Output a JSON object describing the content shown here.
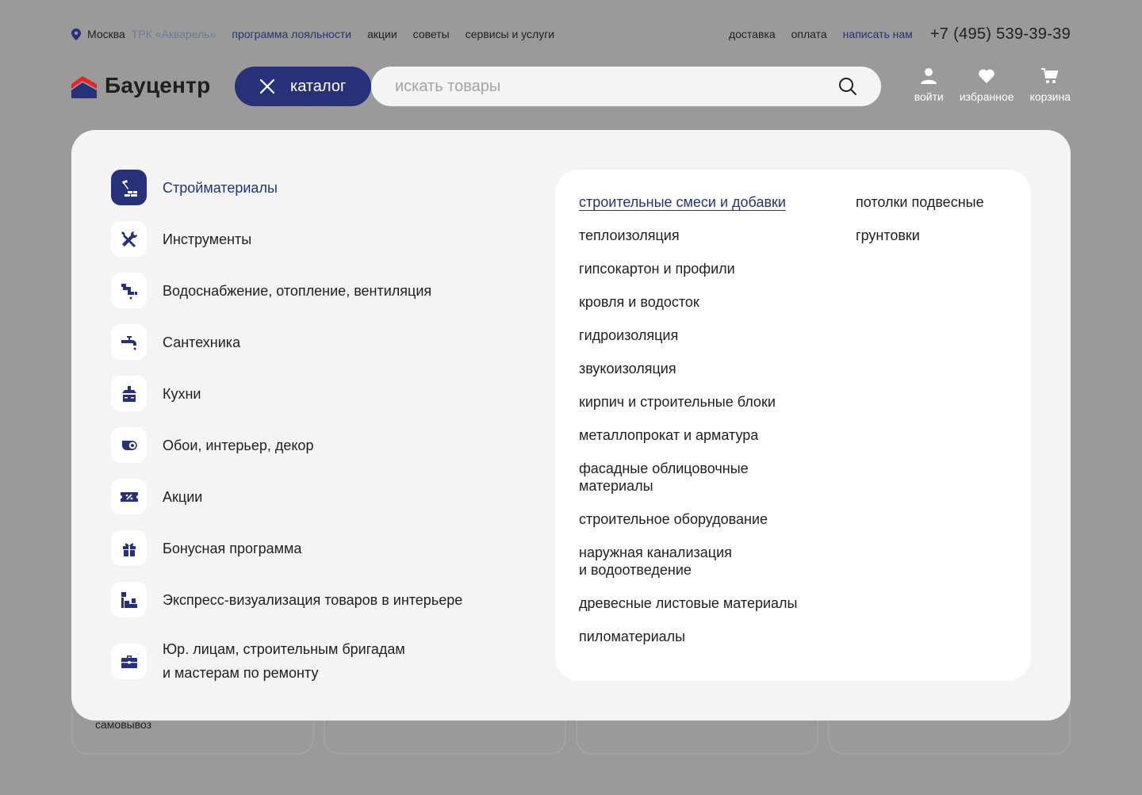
{
  "topbar": {
    "city": "Москва",
    "store": "ТРК «Акварель»",
    "loyalty": "программа лояльности",
    "links": [
      "акции",
      "советы",
      "сервисы и услуги"
    ],
    "right_links": [
      "доставка",
      "оплата"
    ],
    "write_us": "написать нам",
    "phone": "+7 (495) 539-39-39"
  },
  "header": {
    "logo_text": "Бауцентр",
    "catalog_label": "каталог",
    "search_placeholder": "искать товары",
    "login": "войти",
    "favorites": "избранное",
    "cart": "корзина"
  },
  "background": {
    "card_text": "самовывоз"
  },
  "menu": {
    "categories": [
      {
        "label": "Стройматериалы",
        "icon": "bricks-trowel-icon"
      },
      {
        "label": "Инструменты",
        "icon": "tools-icon"
      },
      {
        "label": "Водоснабжение, отопление, вентиляция",
        "icon": "pipe-icon"
      },
      {
        "label": "Сантехника",
        "icon": "faucet-icon"
      },
      {
        "label": "Кухни",
        "icon": "kitchen-hood-icon"
      },
      {
        "label": "Обои, интерьер, декор",
        "icon": "wallpaper-roll-icon"
      },
      {
        "label": "Акции",
        "icon": "discount-ticket-icon"
      },
      {
        "label": "Бонусная программа",
        "icon": "gift-icon"
      },
      {
        "label": "Экспресс-визуализация товаров в интерьере",
        "icon": "interior-visual-icon"
      },
      {
        "label_line1": "Юр. лицам, строительным бригадам",
        "label_line2": "и мастерам по ремонту",
        "icon": "briefcase-icon"
      }
    ],
    "subcategories_col1": [
      "строительные смеси и добавки",
      "теплоизоляция",
      "гипсокартон и профили",
      "кровля и водосток",
      "гидроизоляция",
      "звукоизоляция",
      "кирпич и строительные блоки",
      "металлопрокат и арматура",
      {
        "line1": "фасадные облицовочные",
        "line2": "материалы"
      },
      "строительное оборудование",
      {
        "line1": "наружная канализация",
        "line2": "и водоотведение"
      },
      "древесные листовые материалы",
      "пиломатериалы"
    ],
    "subcategories_col2": [
      "потолки подвесные",
      "грунтовки"
    ]
  },
  "colors": {
    "accent": "#283178",
    "overlay": "#9a9a9a",
    "panel": "#f4f4f4",
    "logo_red": "#e4252b"
  }
}
